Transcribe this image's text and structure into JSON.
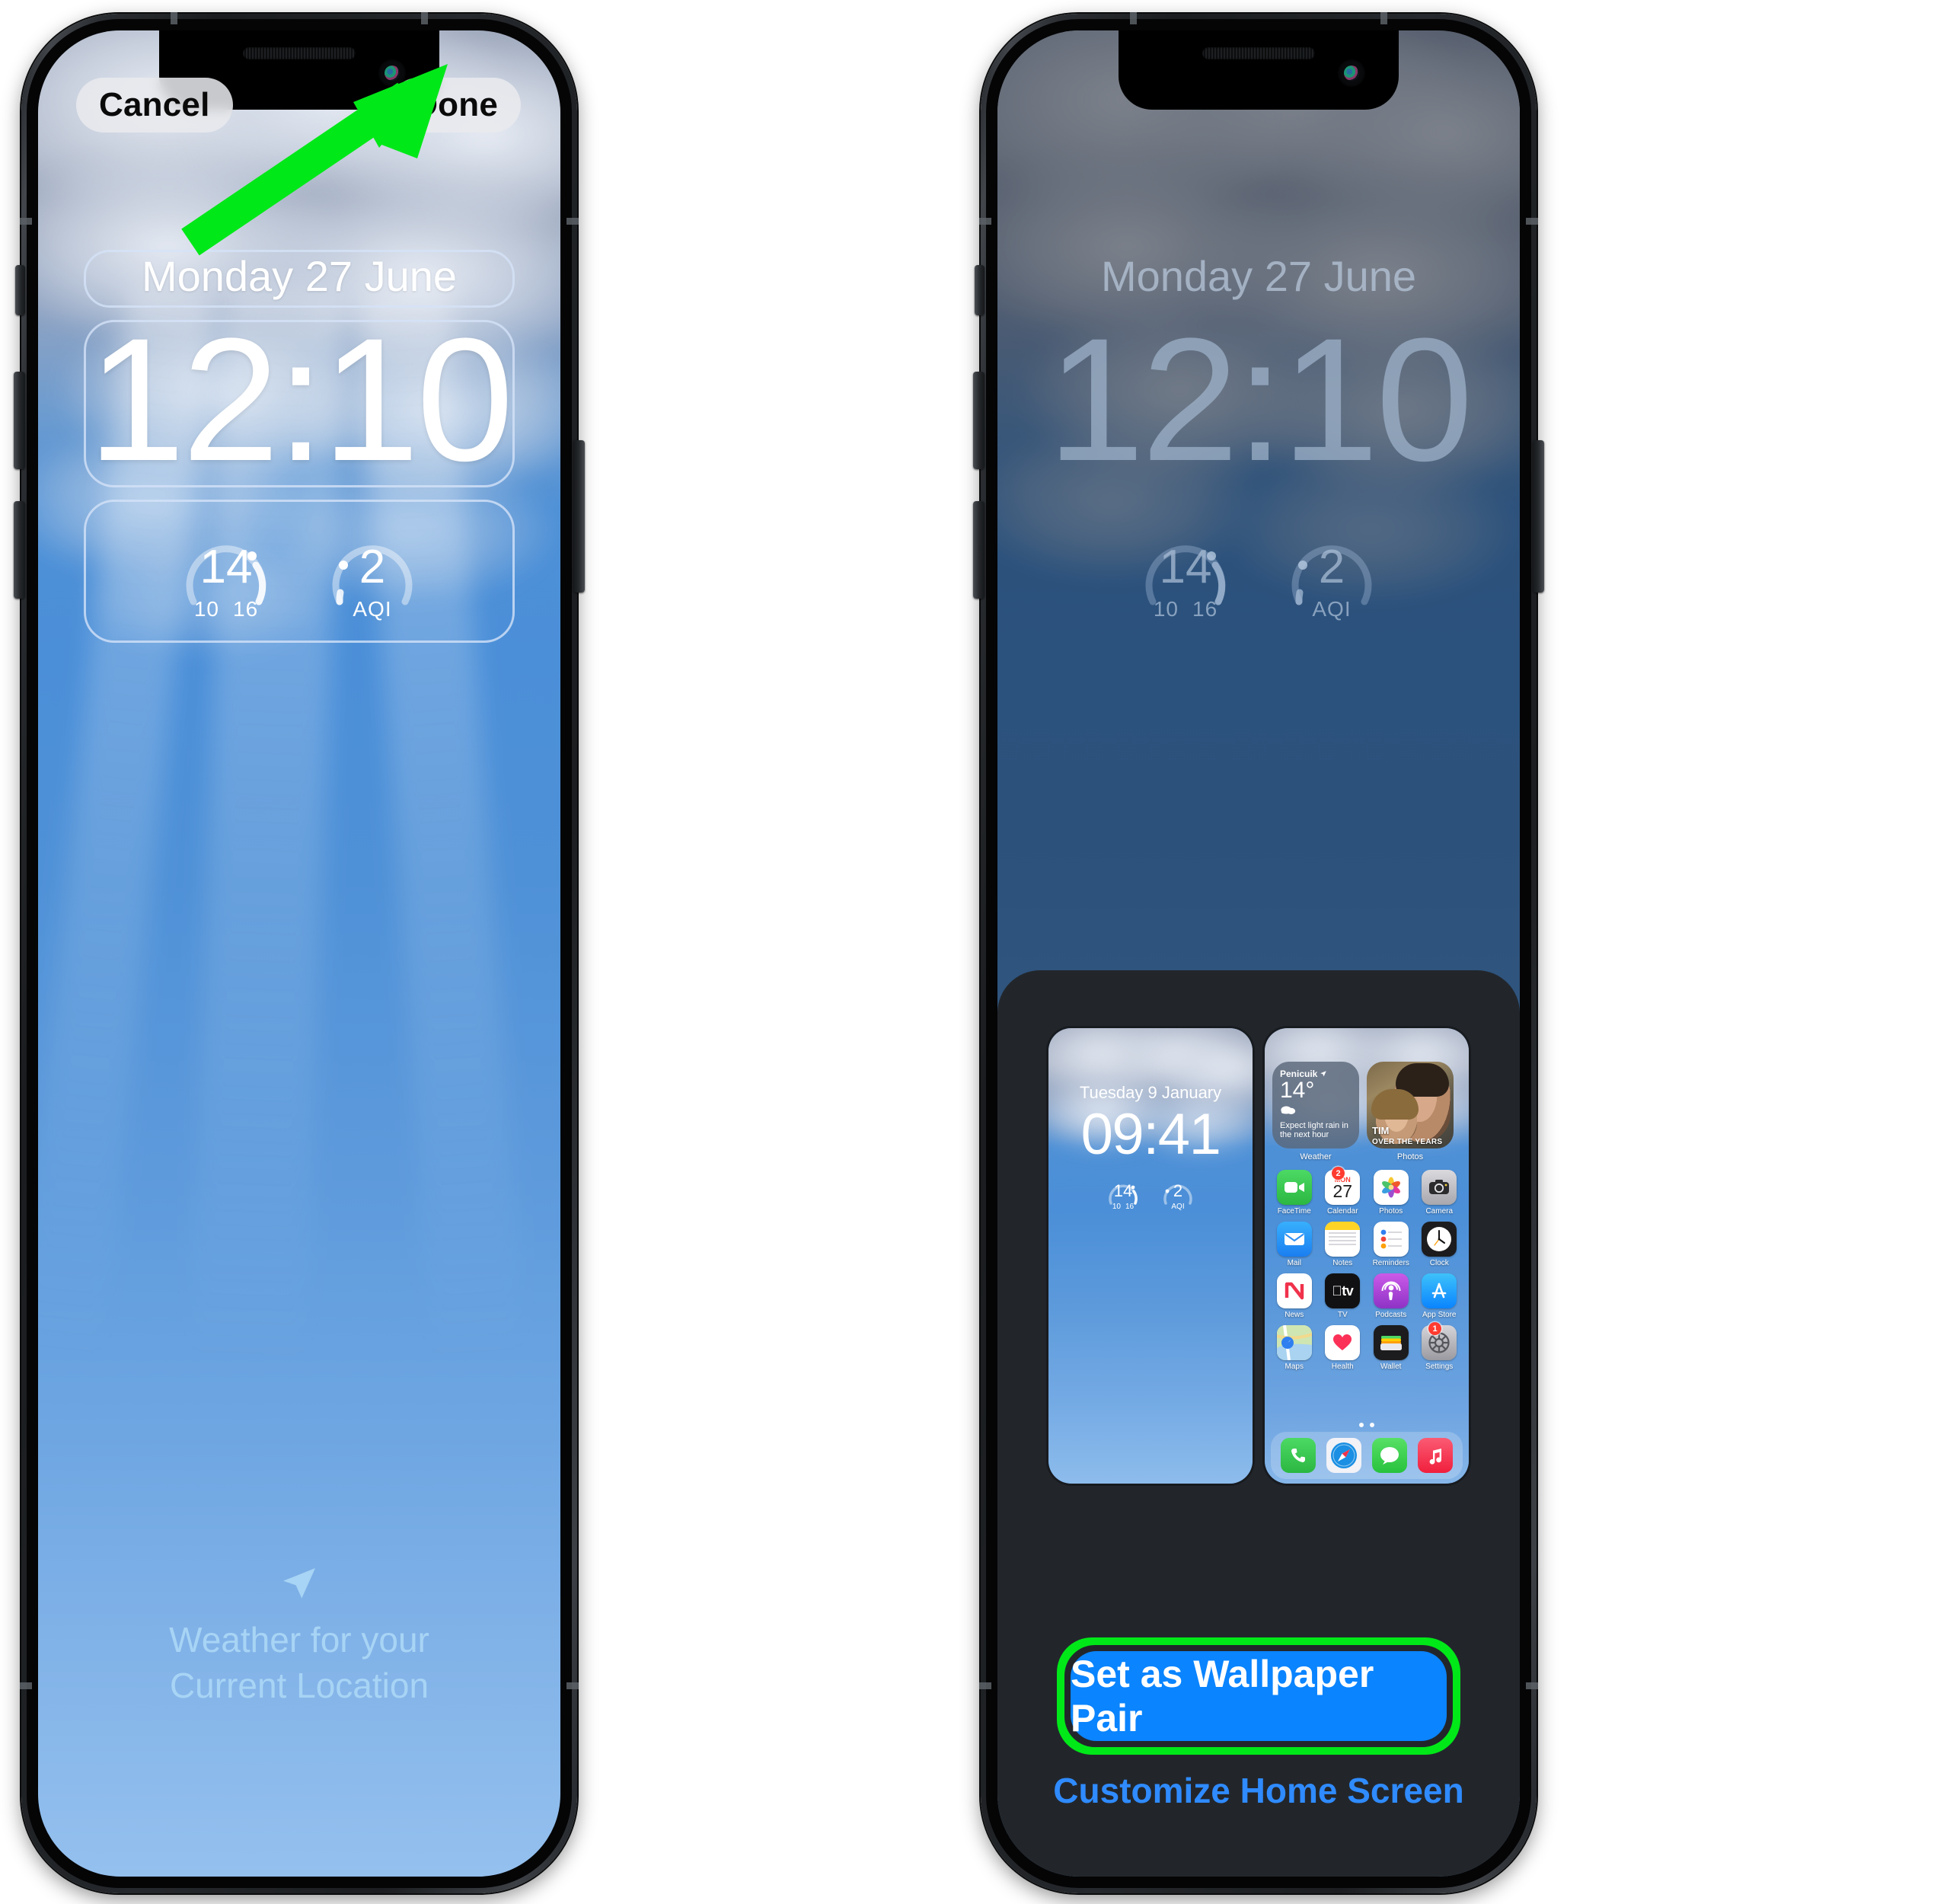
{
  "left_phone": {
    "topbar": {
      "cancel_label": "Cancel",
      "done_label": "Done"
    },
    "lock_screen": {
      "date": "Monday 27 June",
      "time": "12:10",
      "widgets": [
        {
          "name": "temperature-gauge",
          "value": "14",
          "scale_low": "10",
          "scale_high": "16"
        },
        {
          "name": "air-quality-gauge",
          "value": "2",
          "unit": "AQI"
        }
      ],
      "location_note_line1": "Weather for your",
      "location_note_line2": "Current Location",
      "location_icon": "location-arrow-icon"
    },
    "annotation": {
      "type": "arrow",
      "color": "#00e818",
      "points_to": "done-button"
    }
  },
  "right_phone": {
    "lock_screen": {
      "date": "Monday 27 June",
      "time": "12:10",
      "widgets": [
        {
          "name": "temperature-gauge",
          "value": "14",
          "scale_low": "10",
          "scale_high": "16"
        },
        {
          "name": "air-quality-gauge",
          "value": "2",
          "unit": "AQI"
        }
      ]
    },
    "sheet": {
      "lock_preview": {
        "date": "Tuesday 9 January",
        "time": "09:41",
        "widgets": [
          {
            "name": "temperature-gauge",
            "value": "14",
            "scale_low": "10",
            "scale_high": "16"
          },
          {
            "name": "air-quality-gauge",
            "value": "2",
            "unit": "AQI"
          }
        ]
      },
      "home_preview": {
        "weather_widget": {
          "city": "Penicuik",
          "location_icon": "location-arrow-icon",
          "temperature": "14°",
          "condition_icon": "cloud-rain-icon",
          "description": "Expect light rain in the next hour",
          "label": "Weather"
        },
        "photos_widget": {
          "caption_title": "TIM",
          "caption_subtitle": "OVER THE YEARS",
          "label": "Photos"
        },
        "apps": [
          {
            "name": "FaceTime",
            "icon": "facetime-icon",
            "badge": ""
          },
          {
            "name": "Calendar",
            "icon": "calendar-icon",
            "badge": "2",
            "day_label": "MON",
            "day_number": "27"
          },
          {
            "name": "Photos",
            "icon": "photos-icon",
            "badge": ""
          },
          {
            "name": "Camera",
            "icon": "camera-icon",
            "badge": ""
          },
          {
            "name": "Mail",
            "icon": "mail-icon",
            "badge": ""
          },
          {
            "name": "Notes",
            "icon": "notes-icon",
            "badge": ""
          },
          {
            "name": "Reminders",
            "icon": "reminders-icon",
            "badge": ""
          },
          {
            "name": "Clock",
            "icon": "clock-icon",
            "badge": ""
          },
          {
            "name": "News",
            "icon": "news-icon",
            "badge": ""
          },
          {
            "name": "TV",
            "icon": "tv-icon",
            "badge": ""
          },
          {
            "name": "Podcasts",
            "icon": "podcasts-icon",
            "badge": ""
          },
          {
            "name": "App Store",
            "icon": "appstore-icon",
            "badge": ""
          },
          {
            "name": "Maps",
            "icon": "maps-icon",
            "badge": ""
          },
          {
            "name": "Health",
            "icon": "health-icon",
            "badge": ""
          },
          {
            "name": "Wallet",
            "icon": "wallet-icon",
            "badge": ""
          },
          {
            "name": "Settings",
            "icon": "settings-icon",
            "badge": "1"
          }
        ],
        "dock": [
          {
            "name": "Phone",
            "icon": "phone-icon"
          },
          {
            "name": "Safari",
            "icon": "safari-icon"
          },
          {
            "name": "Messages",
            "icon": "messages-icon"
          },
          {
            "name": "Music",
            "icon": "music-icon"
          }
        ],
        "page_dots": 2
      },
      "primary_button": "Set as Wallpaper Pair",
      "secondary_button": "Customize Home Screen",
      "primary_button_color": "#0a84ff",
      "highlight_color": "#00e818"
    }
  }
}
